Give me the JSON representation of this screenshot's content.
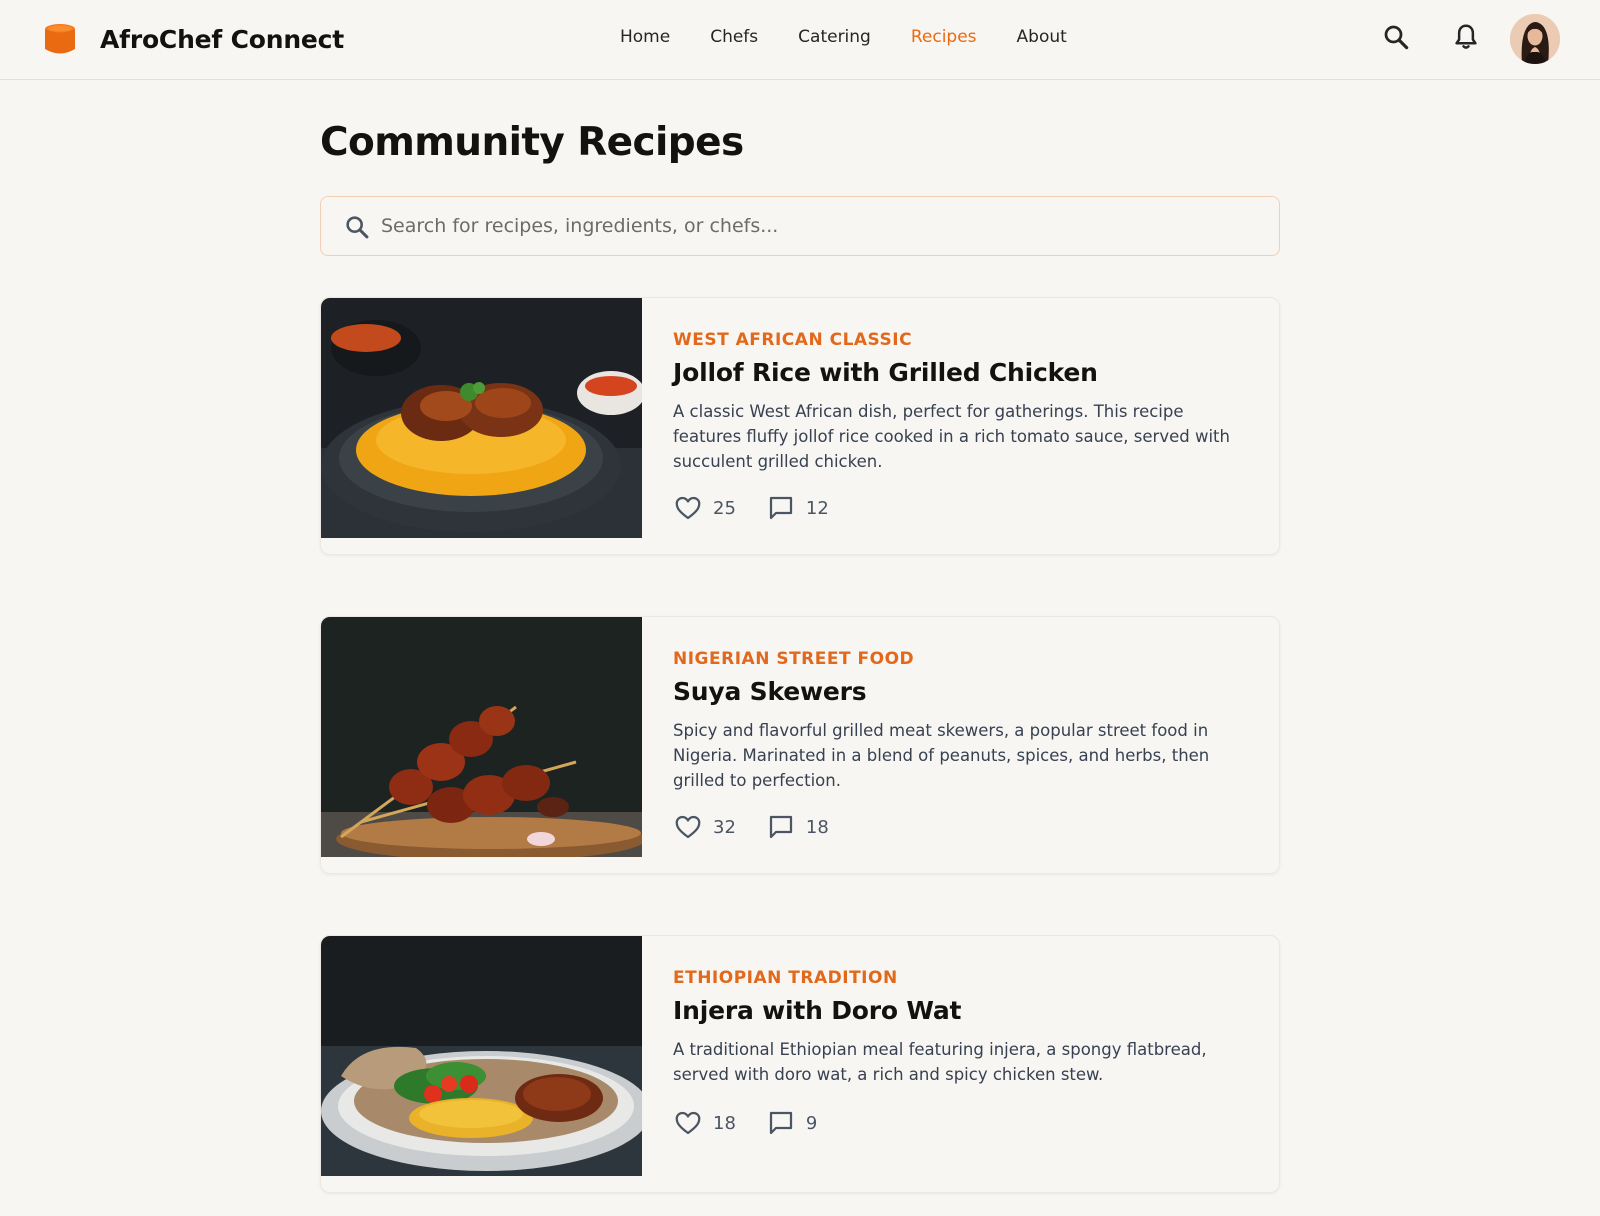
{
  "header": {
    "brand": "AfroChef Connect",
    "nav": [
      "Home",
      "Chefs",
      "Catering",
      "Recipes",
      "About"
    ],
    "active_nav": "Recipes",
    "icons": [
      "search-icon",
      "bell-icon"
    ]
  },
  "main": {
    "title": "Community Recipes",
    "search_placeholder": "Search for recipes, ingredients, or chefs..."
  },
  "recipes": [
    {
      "category": "West African Classic",
      "title": "Jollof Rice with Grilled Chicken",
      "description": "A classic West African dish, perfect for gatherings. This recipe features fluffy jollof rice cooked in a rich tomato sauce, served with succulent grilled chicken.",
      "likes": "25",
      "comments": "12"
    },
    {
      "category": "Nigerian Street Food",
      "title": "Suya Skewers",
      "description": "Spicy and flavorful grilled meat skewers, a popular street food in Nigeria. Marinated in a blend of peanuts, spices, and herbs, then grilled to perfection.",
      "likes": "32",
      "comments": "18"
    },
    {
      "category": "Ethiopian Tradition",
      "title": "Injera with Doro Wat",
      "description": "A traditional Ethiopian meal featuring injera, a spongy flatbread, served with doro wat, a rich and spicy chicken stew.",
      "likes": "18",
      "comments": "9"
    }
  ],
  "colors": {
    "accent": "#ea6a12",
    "background": "#f8f6f3",
    "text": "#141210"
  }
}
